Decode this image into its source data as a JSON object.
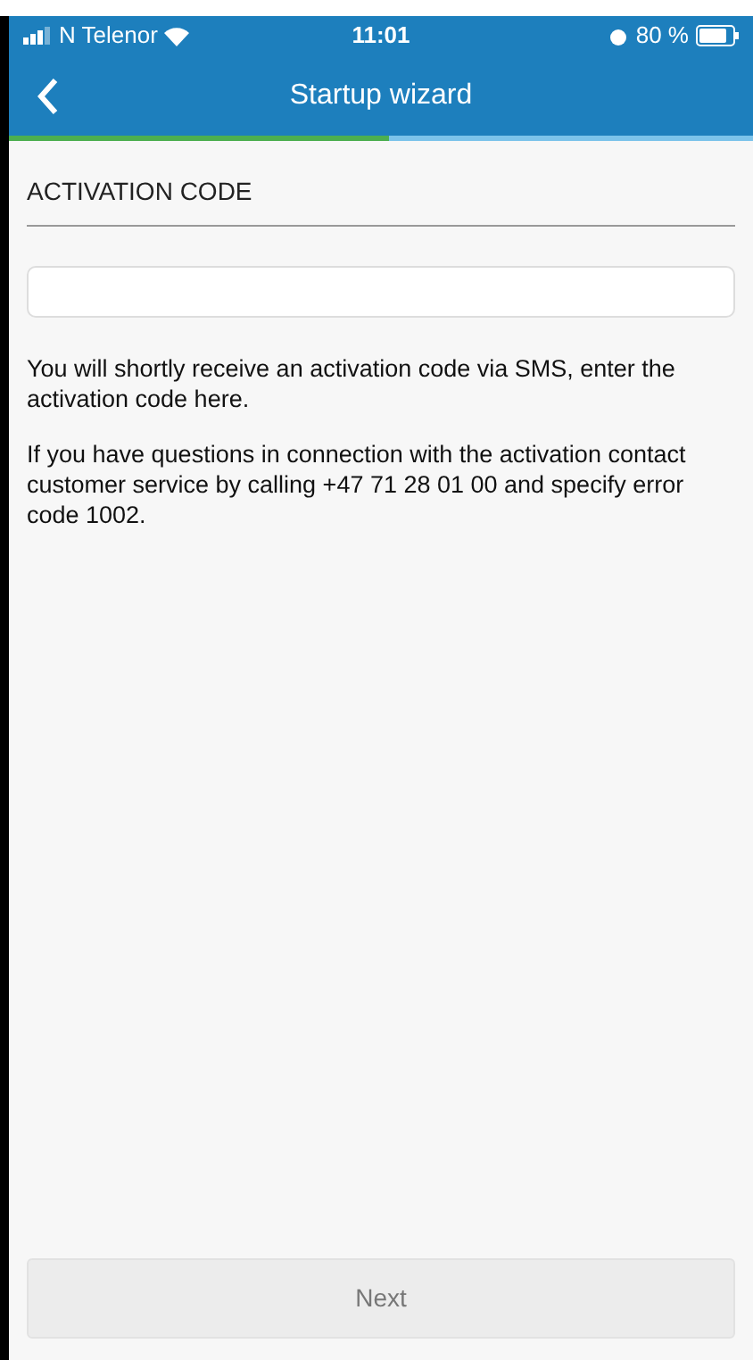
{
  "status_bar": {
    "carrier": "N Telenor",
    "time": "11:01",
    "battery": "80 %"
  },
  "nav": {
    "title": "Startup wizard"
  },
  "progress": {
    "level": 0.51
  },
  "section": {
    "title": "ACTIVATION CODE"
  },
  "paragraphs": [
    "You will shortly receive an activation code via SMS, enter the activation code here.",
    "If you have questions in connection with the activation contact customer service by calling +47 71 28 01 00 and specify error code 1002."
  ],
  "next_button": {
    "label": "Next",
    "disabled": true
  }
}
